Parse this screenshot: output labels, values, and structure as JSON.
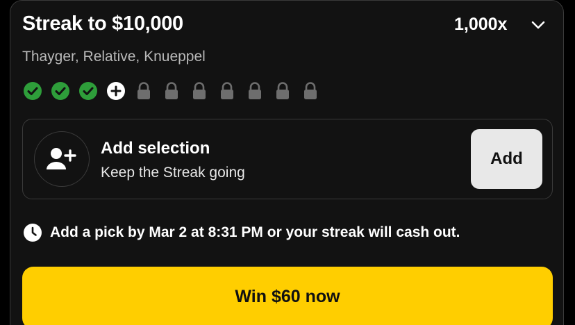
{
  "streak": {
    "title": "Streak to $10,000",
    "multiplier": "1,000x",
    "picks": "Thayger, Relative, Knueppel",
    "progress": {
      "completed": 3,
      "current": 1,
      "locked": 7
    }
  },
  "selection": {
    "title": "Add selection",
    "subtitle": "Keep the Streak going",
    "add_label": "Add"
  },
  "notice": {
    "text": "Add a pick by Mar 2 at 8:31 PM or your streak will cash out."
  },
  "cta": {
    "label": "Win $60 now"
  },
  "colors": {
    "completed": "#2e9e3a",
    "locked": "#6e6e6e",
    "cta": "#ffce00"
  }
}
